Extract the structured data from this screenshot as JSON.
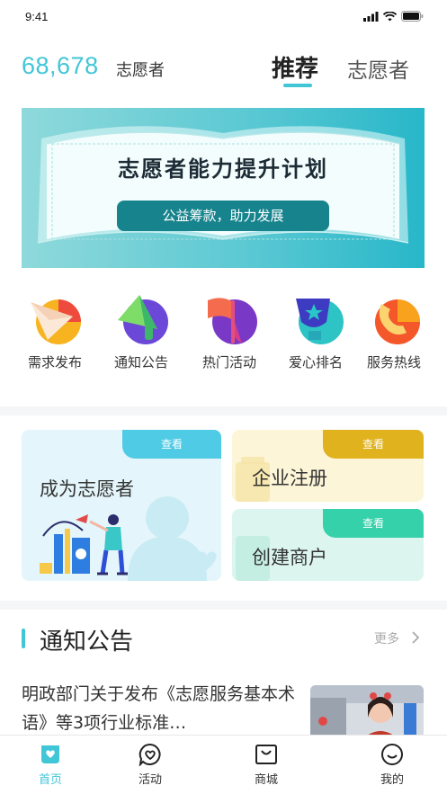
{
  "status_bar": {
    "time": "9:41"
  },
  "header": {
    "volunteer_count": "68,678",
    "volunteer_count_label": "志愿者",
    "tabs": [
      {
        "label": "推荐",
        "active": true
      },
      {
        "label": "志愿者",
        "active": false
      }
    ]
  },
  "banner": {
    "title": "志愿者能力提升计划",
    "subtitle_button": "公益筹款，助力发展"
  },
  "quick_actions": [
    {
      "label": "需求发布",
      "icon": "paper-plane-icon"
    },
    {
      "label": "通知公告",
      "icon": "megaphone-icon"
    },
    {
      "label": "热门活动",
      "icon": "flag-icon"
    },
    {
      "label": "爱心排名",
      "icon": "trophy-icon"
    },
    {
      "label": "服务热线",
      "icon": "phone-icon"
    }
  ],
  "cards": {
    "become_volunteer": {
      "title": "成为志愿者",
      "tag": "查看",
      "color": "#4fcbe6"
    },
    "enterprise_register": {
      "title": "企业注册",
      "tag": "查看",
      "color": "#dfb21e"
    },
    "create_merchant": {
      "title": "创建商户",
      "tag": "查看",
      "color": "#34d1aa"
    }
  },
  "notice_section": {
    "title": "通知公告",
    "more": "更多",
    "items": [
      {
        "text": "明政部门关于发布《志愿服务基本术语》等3项行业标准…"
      }
    ]
  },
  "bottom_tabs": [
    {
      "label": "首页",
      "icon": "home-icon",
      "active": true
    },
    {
      "label": "活动",
      "icon": "heart-chat-icon",
      "active": false
    },
    {
      "label": "商城",
      "icon": "shopping-bag-icon",
      "active": false
    },
    {
      "label": "我的",
      "icon": "smiley-icon",
      "active": false
    }
  ],
  "colors": {
    "accent": "#41c6d8"
  }
}
